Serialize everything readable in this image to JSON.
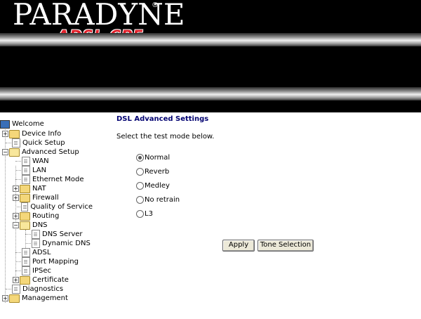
{
  "header": {
    "brand": "PARADYNE",
    "product": "ADSL CPE"
  },
  "nav": {
    "root": "Welcome",
    "items": [
      {
        "label": "Device Info"
      },
      {
        "label": "Quick Setup"
      },
      {
        "label": "Advanced Setup"
      },
      {
        "label": "WAN"
      },
      {
        "label": "LAN"
      },
      {
        "label": "Ethernet Mode"
      },
      {
        "label": "NAT"
      },
      {
        "label": "Firewall"
      },
      {
        "label": "Quality of Service"
      },
      {
        "label": "Routing"
      },
      {
        "label": "DNS"
      },
      {
        "label": "DNS Server"
      },
      {
        "label": "Dynamic DNS"
      },
      {
        "label": "ADSL"
      },
      {
        "label": "Port Mapping"
      },
      {
        "label": "IPSec"
      },
      {
        "label": "Certificate"
      },
      {
        "label": "Diagnostics"
      },
      {
        "label": "Management"
      }
    ]
  },
  "main": {
    "title": "DSL Advanced Settings",
    "instruction": "Select the test mode below.",
    "modes": [
      {
        "label": "Normal",
        "checked": true
      },
      {
        "label": "Reverb",
        "checked": false
      },
      {
        "label": "Medley",
        "checked": false
      },
      {
        "label": "No retrain",
        "checked": false
      },
      {
        "label": "L3",
        "checked": false
      }
    ],
    "apply_label": "Apply",
    "tone_label": "Tone Selection"
  }
}
